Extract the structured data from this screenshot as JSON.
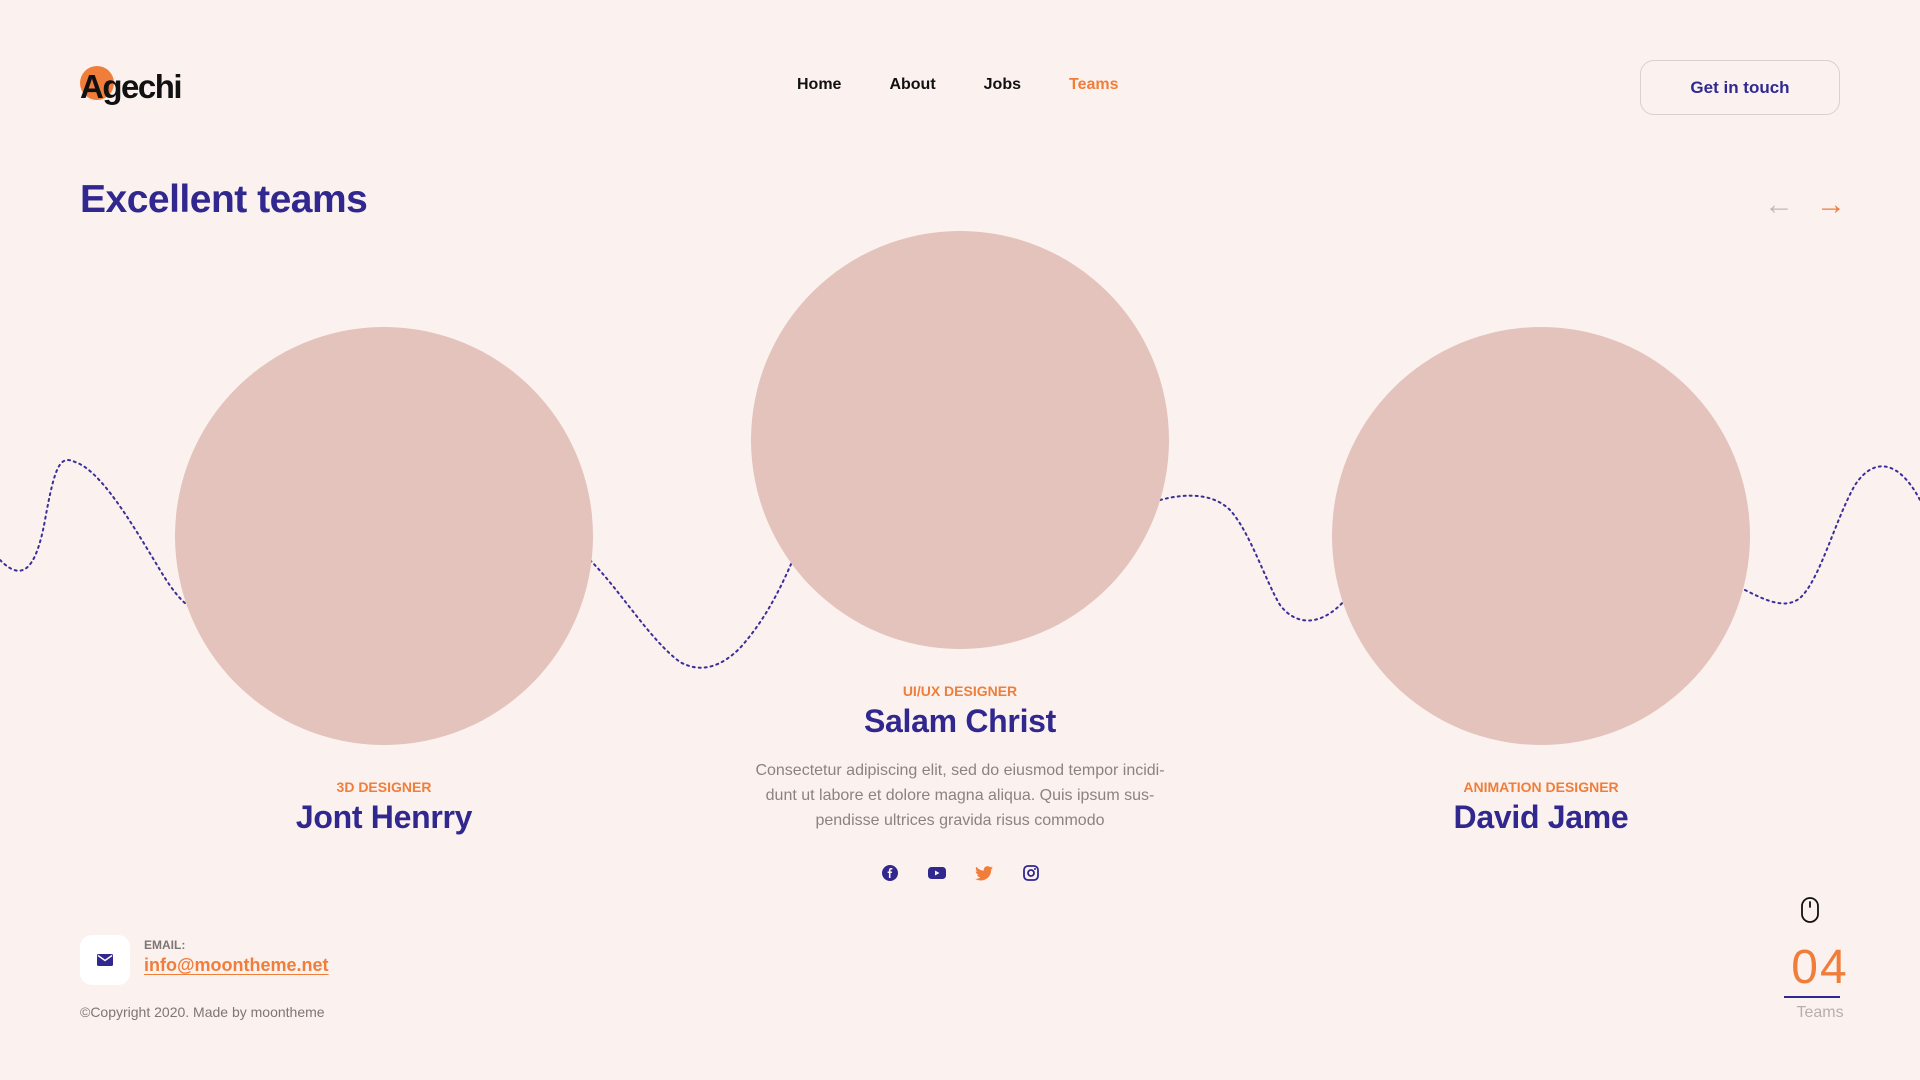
{
  "brand": {
    "logo_text": "Agechi",
    "accent": "#f07e3a",
    "primary": "#30278f",
    "background": "#fbf2ef"
  },
  "nav": {
    "items": [
      {
        "label": "Home"
      },
      {
        "label": "About"
      },
      {
        "label": "Jobs"
      },
      {
        "label": "Teams",
        "active": true
      }
    ],
    "cta_label": "Get in touch"
  },
  "section": {
    "title": "Excellent teams",
    "prev_icon": "arrow-left-icon",
    "next_icon": "arrow-right-icon"
  },
  "team": [
    {
      "role": "3D DESIGNER",
      "name": "Jont Henrry"
    },
    {
      "role": "UI/UX DESIGNER",
      "name": "Salam Christ",
      "bio": "Consectetur adipiscing elit, sed do eiusmod tempor incidi-dunt ut labore et dolore magna aliqua. Quis ipsum sus-pendisse ultrices gravida risus commodo",
      "socials": [
        "facebook-icon",
        "youtube-icon",
        "twitter-icon",
        "instagram-icon"
      ]
    },
    {
      "role": "ANIMATION DESIGNER",
      "name": "David Jame"
    }
  ],
  "footer": {
    "email_label": "EMAIL:",
    "email": "info@moontheme.net",
    "copyright": "©Copyright 2020. Made by moontheme"
  },
  "counter": {
    "number": "04",
    "label": "Teams"
  }
}
